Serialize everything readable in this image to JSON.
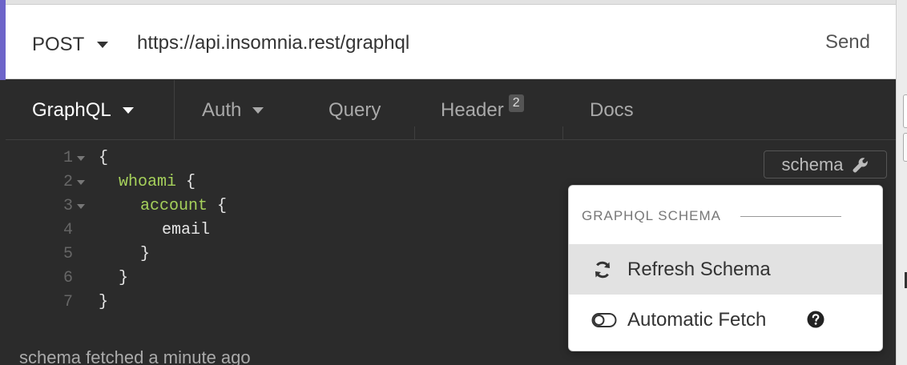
{
  "request": {
    "method": "POST",
    "url": "https://api.insomnia.rest/graphql",
    "send_label": "Send"
  },
  "tabs": [
    {
      "label": "GraphQL",
      "active": true,
      "has_caret": true
    },
    {
      "label": "Auth",
      "active": false,
      "has_caret": true
    },
    {
      "label": "Query",
      "active": false
    },
    {
      "label": "Header",
      "active": false,
      "badge": "2"
    },
    {
      "label": "Docs",
      "active": false
    }
  ],
  "editor": {
    "lines": [
      {
        "n": "1",
        "text": "{"
      },
      {
        "n": "2",
        "text": "whoami {"
      },
      {
        "n": "3",
        "text": "account {"
      },
      {
        "n": "4",
        "text": "email"
      },
      {
        "n": "5",
        "text": "}"
      },
      {
        "n": "6",
        "text": "}"
      },
      {
        "n": "7",
        "text": "}"
      }
    ]
  },
  "schema_button": {
    "label": "schema",
    "icon": "wrench-icon"
  },
  "schema_menu": {
    "header": "GRAPHQL SCHEMA",
    "items": [
      {
        "label": "Refresh Schema",
        "icon": "refresh-icon"
      },
      {
        "label": "Automatic Fetch",
        "icon": "toggle-off-icon",
        "help_icon": "question-circle-icon"
      }
    ]
  },
  "status": {
    "text": "schema fetched a minute ago"
  },
  "colors": {
    "accent": "#6d64c9",
    "editor_bg": "#2b2b2b",
    "keyword": "#a6d15b"
  }
}
